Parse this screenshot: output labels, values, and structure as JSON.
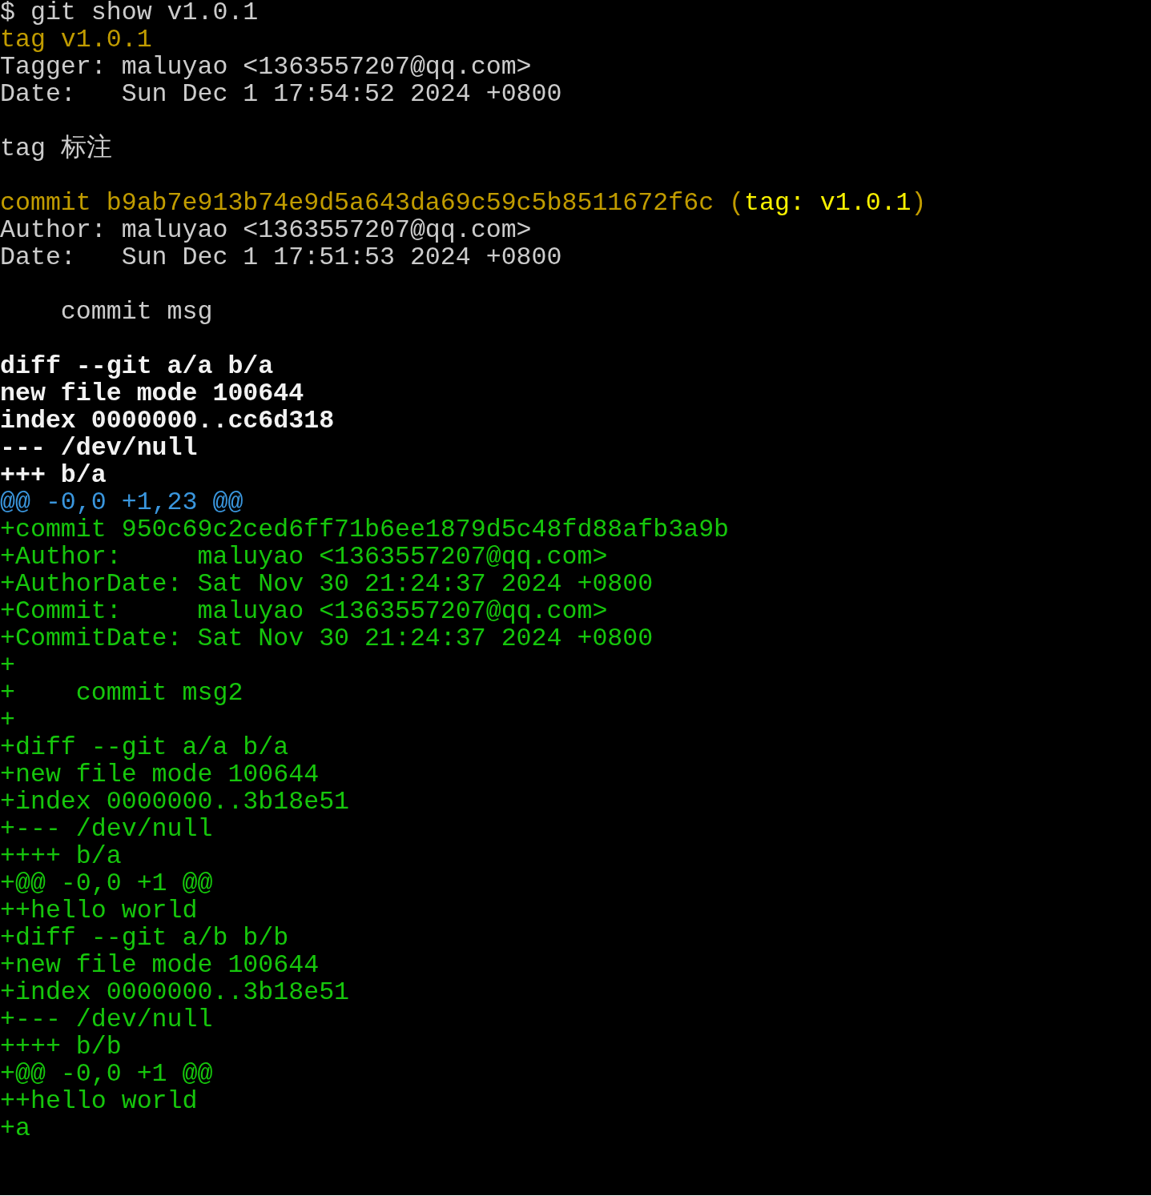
{
  "terminal": {
    "lines": [
      {
        "kind": "text",
        "segments": [
          {
            "text": "$ git show v1.0.1",
            "kind": "plain"
          }
        ]
      },
      {
        "kind": "text",
        "segments": [
          {
            "text": "tag v1.0.1",
            "kind": "yellow"
          }
        ]
      },
      {
        "kind": "text",
        "segments": [
          {
            "text": "Tagger: maluyao <1363557207@qq.com>",
            "kind": "plain"
          }
        ]
      },
      {
        "kind": "text",
        "segments": [
          {
            "text": "Date:   Sun Dec 1 17:54:52 2024 +0800",
            "kind": "plain"
          }
        ]
      },
      {
        "kind": "blank"
      },
      {
        "kind": "text",
        "segments": [
          {
            "text": "tag 标注",
            "kind": "plain"
          }
        ]
      },
      {
        "kind": "blank"
      },
      {
        "kind": "text",
        "segments": [
          {
            "text": "commit b9ab7e913b74e9d5a643da69c59c5b8511672f6c",
            "kind": "yellow"
          },
          {
            "text": " (",
            "kind": "yellow"
          },
          {
            "text": "tag: v1.0.1",
            "kind": "bright_yellow"
          },
          {
            "text": ")",
            "kind": "yellow"
          }
        ]
      },
      {
        "kind": "text",
        "segments": [
          {
            "text": "Author: maluyao <1363557207@qq.com>",
            "kind": "plain"
          }
        ]
      },
      {
        "kind": "text",
        "segments": [
          {
            "text": "Date:   Sun Dec 1 17:51:53 2024 +0800",
            "kind": "plain"
          }
        ]
      },
      {
        "kind": "blank"
      },
      {
        "kind": "text",
        "segments": [
          {
            "text": "    commit msg",
            "kind": "plain"
          }
        ]
      },
      {
        "kind": "blank"
      },
      {
        "kind": "text",
        "segments": [
          {
            "text": "diff --git a/a b/a",
            "kind": "bold"
          }
        ]
      },
      {
        "kind": "text",
        "segments": [
          {
            "text": "new file mode 100644",
            "kind": "bold"
          }
        ]
      },
      {
        "kind": "text",
        "segments": [
          {
            "text": "index 0000000..cc6d318",
            "kind": "bold"
          }
        ]
      },
      {
        "kind": "text",
        "segments": [
          {
            "text": "--- /dev/null",
            "kind": "bold"
          }
        ]
      },
      {
        "kind": "text",
        "segments": [
          {
            "text": "+++ b/a",
            "kind": "bold"
          }
        ]
      },
      {
        "kind": "text",
        "segments": [
          {
            "text": "@@ -0,0 +1,23 @@",
            "kind": "cyan"
          }
        ]
      },
      {
        "kind": "text",
        "segments": [
          {
            "text": "+commit 950c69c2ced6ff71b6ee1879d5c48fd88afb3a9b",
            "kind": "green"
          }
        ]
      },
      {
        "kind": "text",
        "segments": [
          {
            "text": "+Author:     maluyao <1363557207@qq.com>",
            "kind": "green"
          }
        ]
      },
      {
        "kind": "text",
        "segments": [
          {
            "text": "+AuthorDate: Sat Nov 30 21:24:37 2024 +0800",
            "kind": "green"
          }
        ]
      },
      {
        "kind": "text",
        "segments": [
          {
            "text": "+Commit:     maluyao <1363557207@qq.com>",
            "kind": "green"
          }
        ]
      },
      {
        "kind": "text",
        "segments": [
          {
            "text": "+CommitDate: Sat Nov 30 21:24:37 2024 +0800",
            "kind": "green"
          }
        ]
      },
      {
        "kind": "text",
        "segments": [
          {
            "text": "+",
            "kind": "green"
          }
        ]
      },
      {
        "kind": "text",
        "segments": [
          {
            "text": "+    commit msg2",
            "kind": "green"
          }
        ]
      },
      {
        "kind": "text",
        "segments": [
          {
            "text": "+",
            "kind": "green"
          }
        ]
      },
      {
        "kind": "text",
        "segments": [
          {
            "text": "+diff --git a/a b/a",
            "kind": "green"
          }
        ]
      },
      {
        "kind": "text",
        "segments": [
          {
            "text": "+new file mode 100644",
            "kind": "green"
          }
        ]
      },
      {
        "kind": "text",
        "segments": [
          {
            "text": "+index 0000000..3b18e51",
            "kind": "green"
          }
        ]
      },
      {
        "kind": "text",
        "segments": [
          {
            "text": "+--- /dev/null",
            "kind": "green"
          }
        ]
      },
      {
        "kind": "text",
        "segments": [
          {
            "text": "++++ b/a",
            "kind": "green"
          }
        ]
      },
      {
        "kind": "text",
        "segments": [
          {
            "text": "+@@ -0,0 +1 @@",
            "kind": "green"
          }
        ]
      },
      {
        "kind": "text",
        "segments": [
          {
            "text": "++hello world",
            "kind": "green"
          }
        ]
      },
      {
        "kind": "text",
        "segments": [
          {
            "text": "+diff --git a/b b/b",
            "kind": "green"
          }
        ]
      },
      {
        "kind": "text",
        "segments": [
          {
            "text": "+new file mode 100644",
            "kind": "green"
          }
        ]
      },
      {
        "kind": "text",
        "segments": [
          {
            "text": "+index 0000000..3b18e51",
            "kind": "green"
          }
        ]
      },
      {
        "kind": "text",
        "segments": [
          {
            "text": "+--- /dev/null",
            "kind": "green"
          }
        ]
      },
      {
        "kind": "text",
        "segments": [
          {
            "text": "++++ b/b",
            "kind": "green"
          }
        ]
      },
      {
        "kind": "text",
        "segments": [
          {
            "text": "+@@ -0,0 +1 @@",
            "kind": "green"
          }
        ]
      },
      {
        "kind": "text",
        "segments": [
          {
            "text": "++hello world",
            "kind": "green"
          }
        ]
      },
      {
        "kind": "text",
        "segments": [
          {
            "text": "+a",
            "kind": "green"
          }
        ]
      }
    ]
  }
}
